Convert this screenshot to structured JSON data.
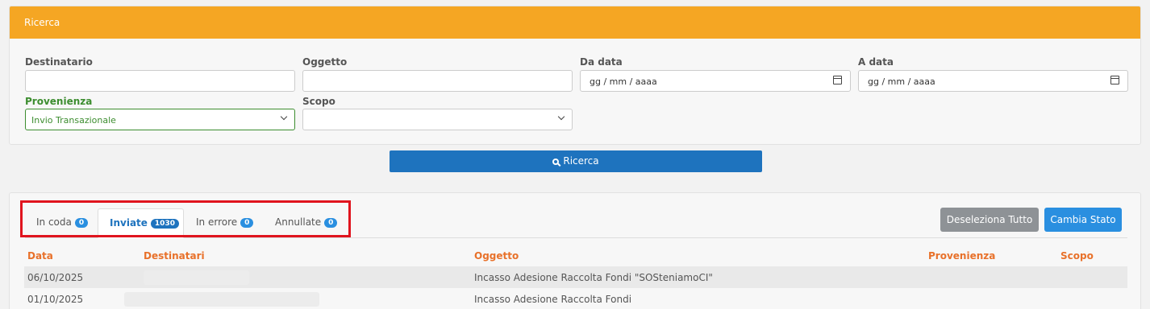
{
  "search_panel": {
    "title": "Ricerca",
    "fields": {
      "destinatario": {
        "label": "Destinatario",
        "value": ""
      },
      "oggetto": {
        "label": "Oggetto",
        "value": ""
      },
      "da_data": {
        "label": "Da data",
        "placeholder": "gg / mm / aaaa"
      },
      "a_data": {
        "label": "A data",
        "placeholder": "gg / mm / aaaa"
      },
      "provenienza": {
        "label": "Provenienza",
        "selected": "Invio Transazionale"
      },
      "scopo": {
        "label": "Scopo",
        "selected": ""
      }
    },
    "search_button": "Ricerca"
  },
  "results": {
    "tabs": [
      {
        "label": "In coda",
        "count": "0",
        "active": false
      },
      {
        "label": "Inviate",
        "count": "1030",
        "active": true
      },
      {
        "label": "In errore",
        "count": "0",
        "active": false
      },
      {
        "label": "Annullate",
        "count": "0",
        "active": false
      }
    ],
    "actions": {
      "deselect_all": "Deseleziona Tutto",
      "change_status": "Cambia Stato"
    },
    "columns": [
      "Data",
      "Destinatari",
      "Oggetto",
      "Provenienza",
      "Scopo"
    ],
    "rows": [
      {
        "data": "06/10/2025",
        "destinatari": "",
        "oggetto": "Incasso Adesione Raccolta Fondi \"SOSteniamoCI\"",
        "provenienza": "",
        "scopo": ""
      },
      {
        "data": "01/10/2025",
        "destinatari": "",
        "oggetto": "Incasso Adesione Raccolta Fondi",
        "provenienza": "",
        "scopo": ""
      }
    ]
  },
  "colors": {
    "header": "#f5a623",
    "primary": "#1e73be",
    "badge": "#2a8fe0",
    "column_header": "#e8712a",
    "highlight_box": "#e0141e"
  }
}
